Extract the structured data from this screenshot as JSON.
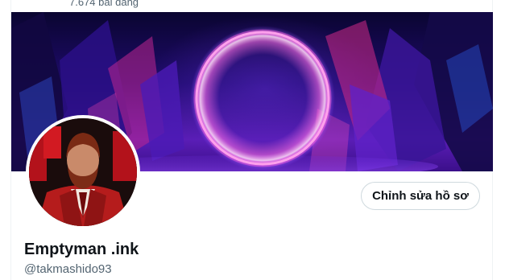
{
  "header": {
    "post_count": "7.674 bài đăng"
  },
  "profile": {
    "display_name": "Emptyman .ink",
    "handle": "@takmashido93",
    "edit_button_label": "Chỉnh sửa hồ sơ",
    "banner_image": "neon-ring-crystal-cave",
    "avatar_image": "bearded-man-red-suit"
  },
  "colors": {
    "text_primary": "#0f1419",
    "text_secondary": "#536471",
    "button_border": "#cfd9de",
    "neon_ring": "#ff5ee0"
  }
}
